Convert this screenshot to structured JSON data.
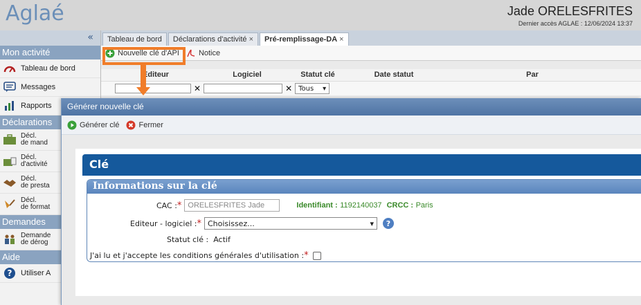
{
  "header": {
    "logo": "Aglaé",
    "user_name": "Jade ORELESFRITES",
    "last_access": "Dernier accès AGLAE : 12/06/2024 13:37"
  },
  "sidebar": {
    "collapse": "«",
    "sections": {
      "activity": "Mon activité",
      "declarations": "Déclarations",
      "demandes": "Demandes",
      "aide": "Aide"
    },
    "items": {
      "dashboard": "Tableau de bord",
      "messages": "Messages",
      "rapports": "Rapports",
      "decl_mand_1": "Décl.",
      "decl_mand_2": "de mand",
      "decl_act_1": "Décl.",
      "decl_act_2": "d'activité",
      "decl_presta_1": "Décl.",
      "decl_presta_2": "de presta",
      "decl_format_1": "Décl.",
      "decl_format_2": "de format",
      "demande_1": "Demande",
      "demande_2": "de dérog",
      "utiliser": "Utiliser A"
    }
  },
  "tabs": [
    {
      "label": "Tableau de bord"
    },
    {
      "label": "Déclarations d'activité",
      "close": "×"
    },
    {
      "label": "Pré-remplissage-DA",
      "close": "×"
    }
  ],
  "toolbar": {
    "new_key": "Nouvelle clé d'API",
    "notice": "Notice"
  },
  "grid": {
    "columns": [
      "Editeur",
      "Logiciel",
      "Statut clé",
      "Date statut",
      "Par"
    ],
    "filter_clear": "✕",
    "status_filter": "Tous"
  },
  "modal": {
    "title": "Générer nouvelle clé",
    "generate": "Générer clé",
    "close": "Fermer",
    "section_title": "Clé",
    "info_title": "Informations sur la clé",
    "cac_label": "CAC :",
    "cac_value": "ORELESFRITES Jade",
    "identifiant_label": "Identifiant :",
    "identifiant_value": "1192140037",
    "crcc_label": "CRCC :",
    "crcc_value": "Paris",
    "editor_label": "Editeur - logiciel :",
    "editor_placeholder": "Choisissez...",
    "status_label": "Statut clé :",
    "status_value": "Actif",
    "cgu_label": "J'ai lu et j'accepte les conditions générales d'utilisation :",
    "required_mark": "*"
  },
  "colors": {
    "brand_blue": "#15599c",
    "highlight_orange": "#f07d2a",
    "section_blue": "#8aa3c0",
    "green_text": "#3a8a2a"
  }
}
